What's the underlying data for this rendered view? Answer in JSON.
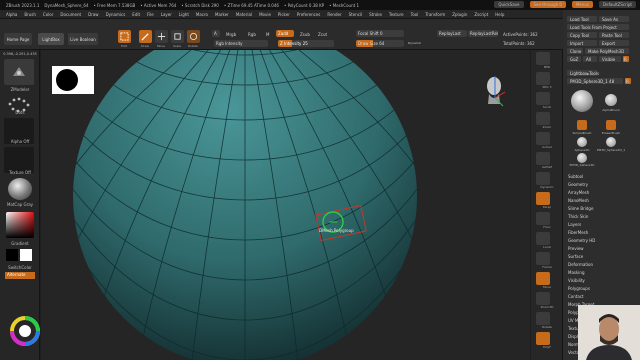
{
  "title_bar": {
    "items": [
      "ZBrush 2023.1.1",
      "DynaMesh_Sphere_64",
      "• Free Mem 7.538GB",
      "• Active Mem 764",
      "• Scratch Disk 290",
      "• ZTime 69.45 ATime 0.046",
      "• PolyCount 0.38 KP",
      "• MeshCount 1"
    ],
    "quicksave": "QuickSave",
    "see_through": "See-through 0",
    "menus_btn": "Menus",
    "default_zscript": "DefaultZScript"
  },
  "menu_bar": {
    "items": [
      "Alpha",
      "Brush",
      "Color",
      "Document",
      "Draw",
      "Dynamics",
      "Edit",
      "File",
      "Layer",
      "Light",
      "Macro",
      "Marker",
      "Material",
      "Movie",
      "Picker",
      "Preferences",
      "Render",
      "Stencil",
      "Stroke",
      "Texture",
      "Tool",
      "Transform",
      "Zplugin",
      "Zscript",
      "Help"
    ]
  },
  "shelf": {
    "home_page": "Home Page",
    "lightbox": "LightBox",
    "live_boolean": "Live Boolean",
    "tools": [
      {
        "label": "Edit",
        "active": true
      },
      {
        "label": "Draw",
        "active": true
      },
      {
        "label": "Move",
        "active": false
      },
      {
        "label": "Scale",
        "active": false
      },
      {
        "label": "Rotate",
        "active": false
      }
    ],
    "mrgb": "Mrgb",
    "rgb": "Rgb",
    "m": "M",
    "zadd": "Zadd",
    "zsub": "Zsub",
    "zcut": "Zcut",
    "rgb_intensity": "Rgb Intensity",
    "z_intensity": "Z Intensity 25",
    "focal_shift": "Focal Shift 0",
    "draw_size": "Draw Size 64",
    "dynamic": "Dynamic",
    "replay_last": "ReplayLast",
    "replay_last_rel": "ReplayLastRel",
    "active_points": "ActivePoints: 362",
    "total_points": "TotalPoints: 362"
  },
  "left_panel": {
    "coords": "0.396,-0.291,0.435",
    "zmodeler": "ZModeler",
    "dots": "Dots",
    "alpha_off": "Alpha Off",
    "texture_off": "Texture Off",
    "matcap": "MatCap Gray",
    "gradient": "Gradient",
    "switch_color": "SwitchColor",
    "alternate": "Alternate"
  },
  "viewport": {
    "cursor_label": "DMesh Polygroup",
    "sphere_color": "#3e8284"
  },
  "right_panel": {
    "labels": [
      "BPR",
      "SPix 3",
      "Scroll",
      "Zoom",
      "Actual",
      "AAHalf",
      "Dynamic",
      "Persp",
      "Floor",
      "Local",
      "Frame",
      "Move",
      "Zoom3D",
      "Rotate",
      "Line Fill",
      "PolyF",
      "Transp",
      "Ghost",
      "Solo",
      "Xpose"
    ]
  },
  "tool_tray": {
    "load_tool": "Load Tool",
    "save_as": "Save As",
    "copy_tool": "Copy Tool",
    "paste_tool": "Paste Tool",
    "import": "Import",
    "export": "Export",
    "clone": "Clone",
    "make_polymesh": "Make PolyMesh3D",
    "goz": "GoZ",
    "all": "All",
    "visible": "Visible",
    "r": "R",
    "load_from_project": "Load Tools From Project",
    "lightbox_tools": "Lightbox▸Tools",
    "current_tool": "PM3D_Sphere3D_1 48",
    "r_val": "R",
    "thumbs": [
      "PM3D_Sphere3D",
      "AlphaBrush",
      "SimpleBrush",
      "EraserBrush",
      "Sphere3D",
      "PM3D_Sphere3D_1",
      "PM3D_Sphere3D"
    ],
    "subpalettes": [
      "Subtool",
      "Geometry",
      "ArrayMesh",
      "NanoMesh",
      "Slime Bridge",
      "Thick Skin",
      "Layers",
      "FiberMesh",
      "Geometry HD",
      "Preview",
      "Surface",
      "Deformation",
      "Masking",
      "Visibility",
      "Polygroups",
      "Contact",
      "Morph Target",
      "Polypaint",
      "UV Map",
      "Texture Map",
      "Displacement Map",
      "Normal Map",
      "Vector Displacement Map"
    ]
  },
  "colors": {
    "accent": "#c66a1c",
    "panel": "#2b2b2b",
    "background": "#252525"
  }
}
